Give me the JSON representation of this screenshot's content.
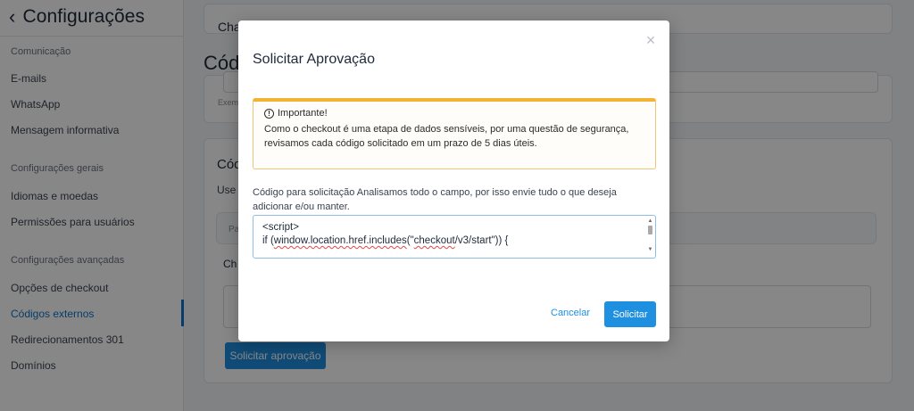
{
  "sidebar": {
    "title": "Configurações",
    "items": [
      {
        "label": "Comunicação"
      },
      {
        "label": "E-mails"
      },
      {
        "label": "WhatsApp"
      },
      {
        "label": "Mensagem informativa"
      },
      {
        "label": "Configurações gerais"
      },
      {
        "label": "Idiomas e moedas"
      },
      {
        "label": "Permissões para usuários"
      },
      {
        "label": "Configurações avançadas"
      },
      {
        "label": "Opções de checkout"
      },
      {
        "label": "Códigos externos"
      },
      {
        "label": "Redirecionamentos 301"
      },
      {
        "label": "Domínios"
      }
    ]
  },
  "background": {
    "card1_partial_title": "Cha",
    "page_title_partial": "Cód",
    "helper_partial": "Exem",
    "card2_title_partial": "Cód",
    "card2_text_partial": "Use",
    "table_head_partial": "Pa",
    "row_partial": "Ch",
    "request_button": "Solicitar aprovação"
  },
  "modal": {
    "title": "Solicitar Aprovação",
    "close_symbol": "×",
    "alert": {
      "icon_symbol": "!",
      "heading": "Importante!",
      "body": "Como o checkout é uma etapa de dados sensíveis, por uma questão de segurança, revisamos cada código solicitado em um prazo de 5 dias úteis."
    },
    "field_label": "Código para solicitação Analisamos todo o campo, por isso envie tudo o que deseja adicionar e/ou manter.",
    "code": {
      "line1": "<script>",
      "line2_prefix": "if (",
      "line2_spell1": "window.location.href.includes",
      "line2_mid": "(\"",
      "line2_spell2": "checkout",
      "line2_suffix": "/v3/start\")) {"
    },
    "cancel_label": "Cancelar",
    "submit_label": "Solicitar"
  },
  "colors": {
    "accent": "#1f8fe0",
    "warning_border": "#f5b335",
    "overlay": "rgba(0,0,0,0.47)"
  }
}
